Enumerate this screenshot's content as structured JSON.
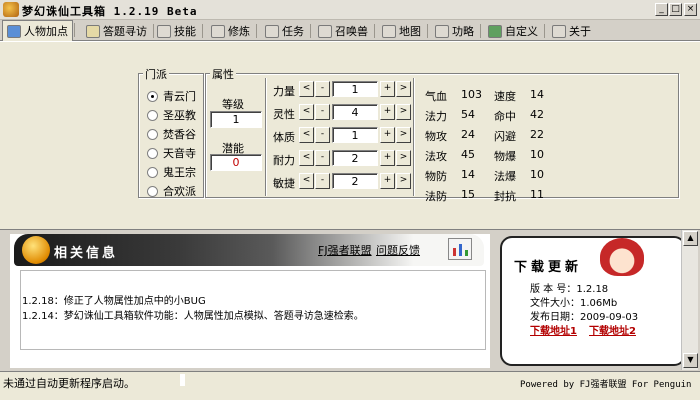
{
  "window": {
    "title": "梦幻诛仙工具箱  1.2.19 Beta",
    "controls": [
      "_",
      "□",
      "×"
    ]
  },
  "tabs": [
    {
      "label": "人物加点",
      "icon": "person-icon",
      "active": true
    },
    {
      "label": "答题寻访",
      "icon": "quiz-icon"
    },
    {
      "label": "技能",
      "icon": "skill-icon"
    },
    {
      "label": "修炼",
      "icon": "cultivate-icon"
    },
    {
      "label": "任务",
      "icon": "task-icon"
    },
    {
      "label": "召唤兽",
      "icon": "pet-icon"
    },
    {
      "label": "地图",
      "icon": "map-icon"
    },
    {
      "label": "功略",
      "icon": "guide-icon"
    },
    {
      "label": "自定义",
      "icon": "custom-icon"
    },
    {
      "label": "关于",
      "icon": "about-icon"
    }
  ],
  "sect": {
    "legend": "门派",
    "options": [
      "青云门",
      "圣巫教",
      "焚香谷",
      "天音寺",
      "鬼王宗",
      "合欢派"
    ],
    "selected": 0
  },
  "attributes": {
    "legend": "属性",
    "level_label": "等级",
    "level_value": "1",
    "potential_label": "潜能",
    "potential_value": "0",
    "rows": [
      {
        "label": "力量",
        "value": "1"
      },
      {
        "label": "灵性",
        "value": "4"
      },
      {
        "label": "体质",
        "value": "1"
      },
      {
        "label": "耐力",
        "value": "2"
      },
      {
        "label": "敏捷",
        "value": "2"
      }
    ],
    "buttons": {
      "first": "<",
      "dec": "-",
      "inc": "+",
      "last": ">"
    }
  },
  "stats": [
    {
      "l1": "气血",
      "v1": "103",
      "l2": "速度",
      "v2": "14"
    },
    {
      "l1": "法力",
      "v1": "54",
      "l2": "命中",
      "v2": "42"
    },
    {
      "l1": "物攻",
      "v1": "24",
      "l2": "闪避",
      "v2": "22"
    },
    {
      "l1": "法攻",
      "v1": "45",
      "l2": "物爆",
      "v2": "10"
    },
    {
      "l1": "物防",
      "v1": "14",
      "l2": "法爆",
      "v2": "10"
    },
    {
      "l1": "法防",
      "v1": "15",
      "l2": "封抗",
      "v2": "11"
    }
  ],
  "info": {
    "title": "相关信息",
    "links": [
      "FJ强者联盟",
      "问题反馈"
    ],
    "notes": [
      "1.2.18：修正了人物属性加点中的小BUG",
      "1.2.14：梦幻诛仙工具箱软件功能：人物属性加点模拟、答题寻访急速检索。"
    ]
  },
  "download": {
    "title": "下载更新",
    "version_label": "版 本 号：",
    "version": "1.2.18",
    "size_label": "文件大小：",
    "size": "1.06Mb",
    "date_label": "发布日期：",
    "date": "2009-09-03",
    "link1": "下载地址1",
    "link2": "下载地址2"
  },
  "status": {
    "left": "未通过自动更新程序启动。",
    "right": "Powered by FJ强者联盟 For Penguin"
  }
}
